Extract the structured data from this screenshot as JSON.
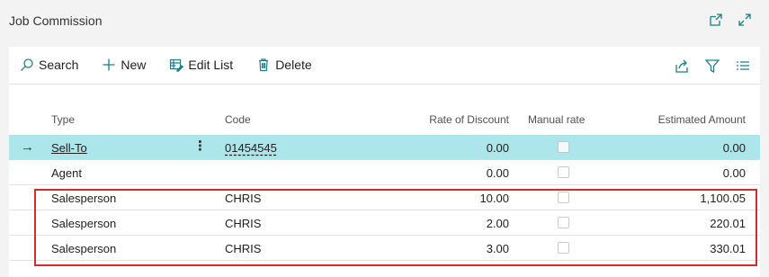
{
  "page": {
    "title": "Job Commission",
    "icons": [
      "open-new-window-icon",
      "expand-icon"
    ]
  },
  "toolbar": {
    "search_label": "Search",
    "new_label": "New",
    "edit_list_label": "Edit List",
    "delete_label": "Delete",
    "right_icons": [
      "share-icon",
      "filter-icon",
      "list-view-icon"
    ]
  },
  "columns": {
    "type": "Type",
    "code": "Code",
    "rate": "Rate of Discount",
    "manual": "Manual rate",
    "estimated": "Estimated Amount"
  },
  "rows": [
    {
      "type": "Sell-To",
      "code": "01454545",
      "rate": "0.00",
      "manual": false,
      "estimated": "0.00",
      "selected": true
    },
    {
      "type": "Agent",
      "code": "",
      "rate": "0.00",
      "manual": false,
      "estimated": "0.00",
      "selected": false
    },
    {
      "type": "Salesperson",
      "code": "CHRIS",
      "rate": "10.00",
      "manual": false,
      "estimated": "1,100.05",
      "selected": false
    },
    {
      "type": "Salesperson",
      "code": "CHRIS",
      "rate": "2.00",
      "manual": false,
      "estimated": "220.01",
      "selected": false
    },
    {
      "type": "Salesperson",
      "code": "CHRIS",
      "rate": "3.00",
      "manual": false,
      "estimated": "330.01",
      "selected": false
    }
  ],
  "colors": {
    "accent": "#1a7f86",
    "selected_row": "#ace5ea",
    "highlight_border": "#d62a2a"
  }
}
